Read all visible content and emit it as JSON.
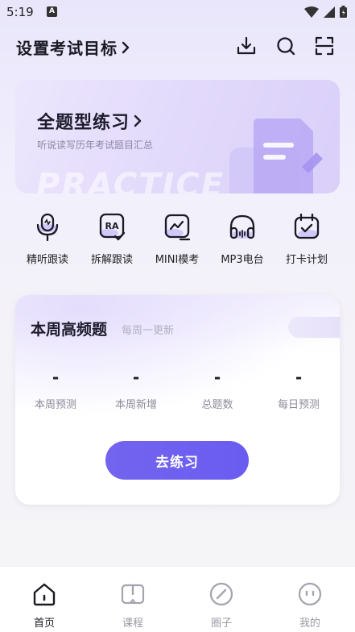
{
  "status_bar": {
    "time": "5:19",
    "notification_badge": "A"
  },
  "header": {
    "goal_label": "设置考试目标",
    "icons": [
      "download-icon",
      "search-icon",
      "scan-icon"
    ]
  },
  "practice_card": {
    "title": "全题型练习",
    "subtitle": "听说读写历年考试题目汇总",
    "watermark": "PRACTICE"
  },
  "quick_actions": [
    {
      "label": "精听跟读",
      "icon": "microphone-icon"
    },
    {
      "label": "拆解跟读",
      "icon": "ra-icon",
      "icon_text": "RA"
    },
    {
      "label": "MINI模考",
      "icon": "mock-exam-icon"
    },
    {
      "label": "MP3电台",
      "icon": "headphones-icon"
    },
    {
      "label": "打卡计划",
      "icon": "calendar-check-icon"
    }
  ],
  "weekly_card": {
    "title": "本周高频题",
    "subtitle": "每周一更新",
    "stats": [
      {
        "value": "-",
        "label": "本周预测"
      },
      {
        "value": "-",
        "label": "本周新增"
      },
      {
        "value": "-",
        "label": "总题数"
      },
      {
        "value": "-",
        "label": "每日预测"
      }
    ],
    "button_label": "去练习"
  },
  "bottom_nav": {
    "active": "首页",
    "tabs": [
      {
        "label": "首页",
        "icon": "home-icon"
      },
      {
        "label": "课程",
        "icon": "course-book-icon"
      },
      {
        "label": "圈子",
        "icon": "compass-icon"
      },
      {
        "label": "我的",
        "icon": "profile-face-icon"
      }
    ]
  },
  "colors": {
    "accent": "#6c5ef0",
    "background": "#f5f5f7"
  }
}
